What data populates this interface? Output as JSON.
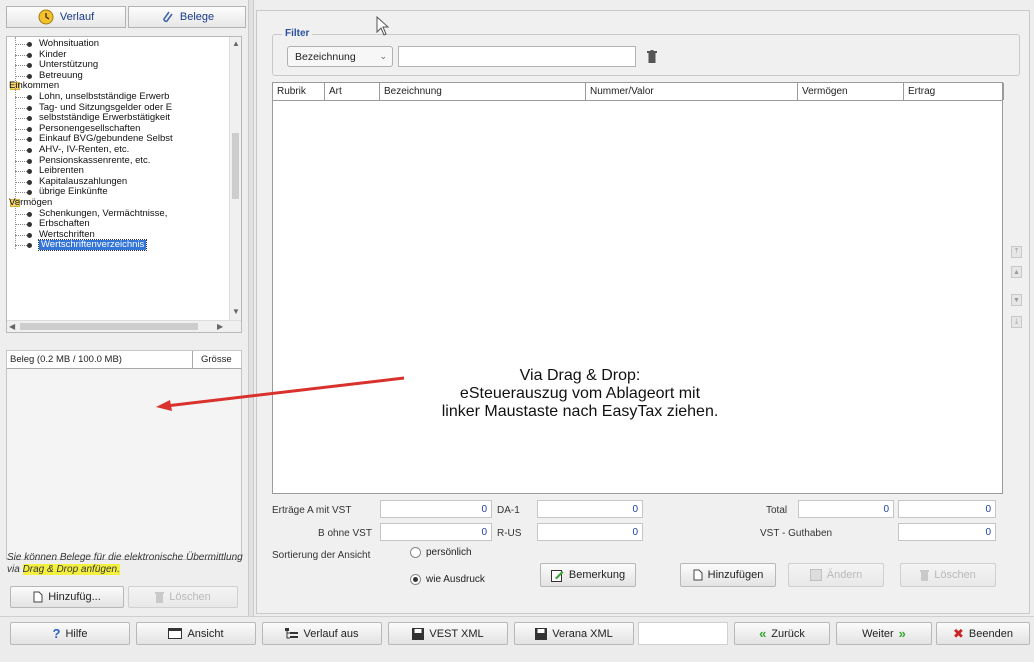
{
  "left_tabs": {
    "verlauf": "Verlauf",
    "belege": "Belege"
  },
  "tree": [
    {
      "label": "Wohnsituation",
      "level": 2
    },
    {
      "label": "Kinder",
      "level": 2
    },
    {
      "label": "Unterstützung",
      "level": 2
    },
    {
      "label": "Betreuung",
      "level": 2
    },
    {
      "label": "Einkommen",
      "level": 1
    },
    {
      "label": "Lohn, unselbstständige Erwerb",
      "level": 2
    },
    {
      "label": "Tag- und Sitzungsgelder oder E",
      "level": 2
    },
    {
      "label": "selbstständige Erwerbstätigkeit",
      "level": 2
    },
    {
      "label": "Personengesellschaften",
      "level": 2
    },
    {
      "label": "Einkauf BVG/gebundene Selbst",
      "level": 2
    },
    {
      "label": "AHV-, IV-Renten, etc.",
      "level": 2
    },
    {
      "label": "Pensionskassenrente, etc.",
      "level": 2
    },
    {
      "label": "Leibrenten",
      "level": 2
    },
    {
      "label": "Kapitalauszahlungen",
      "level": 2
    },
    {
      "label": "übrige Einkünfte",
      "level": 2
    },
    {
      "label": "Vermögen",
      "level": 1
    },
    {
      "label": "Schenkungen, Vermächtnisse,",
      "level": 2
    },
    {
      "label": "Erbschaften",
      "level": 2
    },
    {
      "label": "Wertschriften",
      "level": 2
    },
    {
      "label": "Wertschriftenverzeichnis",
      "level": 2,
      "selected": true
    }
  ],
  "beleg_list": {
    "col_name": "Beleg (0.2 MB / 100.0 MB)",
    "col_size": "Grösse"
  },
  "hint": {
    "prefix": "Sie können Belege für die elektronische Übermittlung via ",
    "highlight": "Drag & Drop anfügen",
    "suffix": "."
  },
  "left_buttons": {
    "add": "Hinzufüg...",
    "delete": "Löschen"
  },
  "filter": {
    "legend": "Filter",
    "select_value": "Bezeichnung",
    "input_value": ""
  },
  "table": {
    "columns": [
      "Rubrik",
      "Art",
      "Bezeichnung",
      "Nummer/Valor",
      "Vermögen",
      "Ertrag"
    ]
  },
  "annotation": {
    "line1": "Via Drag & Drop:",
    "line2": "eSteuerauszug vom Ablageort mit",
    "line3": "linker Maustaste nach EasyTax ziehen."
  },
  "totals": {
    "ertraege_label": "Erträge",
    "a_label": "A mit VST",
    "a_value": "0",
    "b_label": "B ohne VST",
    "b_value": "0",
    "da1_label": "DA-1",
    "da1_value": "0",
    "rus_label": "R-US",
    "rus_value": "0",
    "total_label": "Total",
    "total_value": "0",
    "total_value2": "0",
    "vst_label": "VST - Guthaben",
    "vst_value": "0"
  },
  "sort": {
    "label": "Sortierung der Ansicht",
    "opt1": "persönlich",
    "opt2": "wie Ausdruck",
    "selected": "wie Ausdruck"
  },
  "actions": {
    "bemerkung": "Bemerkung",
    "hinzufuegen": "Hinzufügen",
    "aendern": "Ändern",
    "loeschen": "Löschen"
  },
  "bottom_bar": {
    "hilfe": "Hilfe",
    "ansicht": "Ansicht",
    "verlauf_aus": "Verlauf aus",
    "vest_xml": "VEST XML",
    "verana_xml": "Verana XML",
    "zurueck": "Zurück",
    "weiter": "Weiter",
    "beenden": "Beenden"
  },
  "colors": {
    "accent": "#3375d6",
    "highlight": "#f4f040",
    "arrow": "#d9322d",
    "nav_green": "#3aa635",
    "close_red": "#cc2222"
  }
}
